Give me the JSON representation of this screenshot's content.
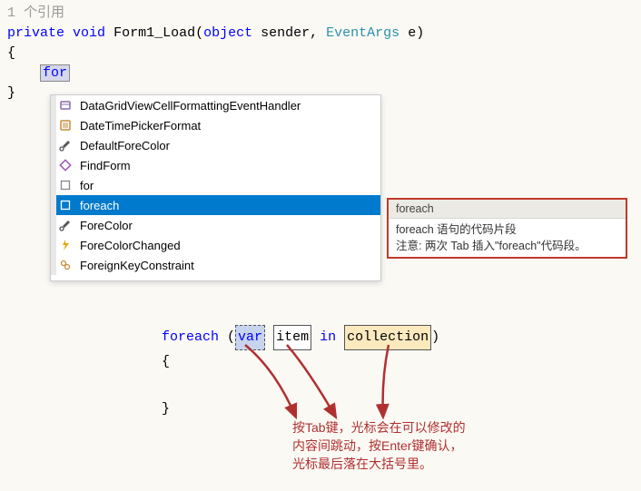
{
  "header": {
    "references": "1 个引用"
  },
  "code": {
    "kw_private": "private",
    "kw_void": "void",
    "method": "Form1_Load",
    "kw_object": "object",
    "param1": "sender",
    "type2": "EventArgs",
    "param2": "e",
    "brace_open": "{",
    "brace_close": "}",
    "typed": "for"
  },
  "autocomplete": {
    "items": [
      {
        "label": "DataGridViewCellFormattingEventHandler",
        "icon": "delegate"
      },
      {
        "label": "DateTimePickerFormat",
        "icon": "enum"
      },
      {
        "label": "DefaultForeColor",
        "icon": "property"
      },
      {
        "label": "FindForm",
        "icon": "method"
      },
      {
        "label": "for",
        "icon": "snippet"
      },
      {
        "label": "foreach",
        "icon": "snippet",
        "selected": true
      },
      {
        "label": "ForeColor",
        "icon": "property"
      },
      {
        "label": "ForeColorChanged",
        "icon": "event"
      },
      {
        "label": "ForeignKeyConstraint",
        "icon": "class"
      }
    ]
  },
  "tooltip": {
    "head": "foreach",
    "line1": "foreach 语句的代码片段",
    "line2": "注意: 两次 Tab 插入\"foreach\"代码段。"
  },
  "snippet": {
    "kw_foreach": "foreach",
    "paren_open": "(",
    "var": "var",
    "item": "item",
    "kw_in": "in",
    "collection": "collection",
    "paren_close": ")",
    "brace_open": "{",
    "brace_close": "}"
  },
  "hint": {
    "l1": "按Tab键，光标会在可以修改的",
    "l2": "内容间跳动，按Enter键确认，",
    "l3": "光标最后落在大括号里。"
  }
}
